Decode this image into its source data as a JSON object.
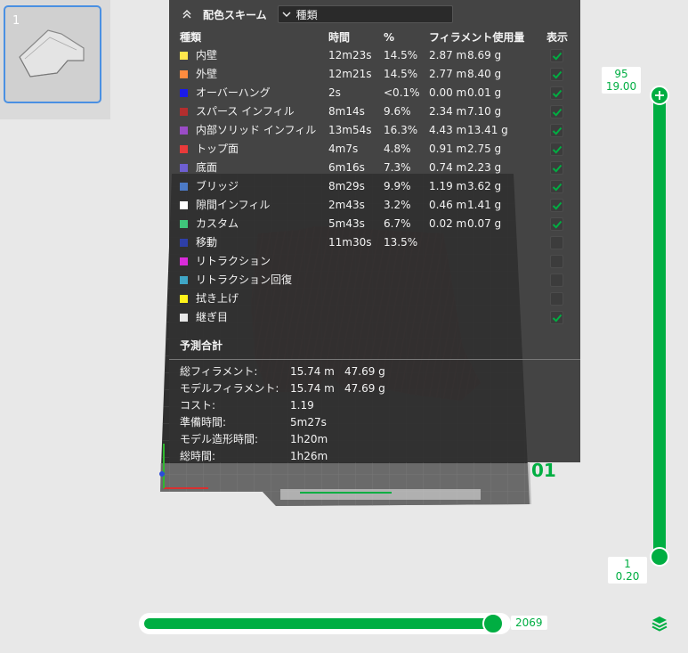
{
  "thumbnail": {
    "plate_number": "1"
  },
  "legend": {
    "title": "配色スキーム",
    "scheme_value": "種類",
    "columns": {
      "type": "種類",
      "time": "時間",
      "percent": "%",
      "filament": "フィラメント使用量",
      "display": "表示"
    },
    "rows": [
      {
        "name": "内壁",
        "color": "#FFE74C",
        "time": "12m23s",
        "percent": "14.5%",
        "length": "2.87 m",
        "weight": "8.69 g",
        "visible": true
      },
      {
        "name": "外壁",
        "color": "#FF8C3F",
        "time": "12m21s",
        "percent": "14.5%",
        "length": "2.77 m",
        "weight": "8.40 g",
        "visible": true
      },
      {
        "name": "オーバーハング",
        "color": "#1A1AE8",
        "time": "2s",
        "percent": "<0.1%",
        "length": "0.00 m",
        "weight": "0.01 g",
        "visible": true
      },
      {
        "name": "スパース インフィル",
        "color": "#B32E2E",
        "time": "8m14s",
        "percent": "9.6%",
        "length": "2.34 m",
        "weight": "7.10 g",
        "visible": true
      },
      {
        "name": "内部ソリッド インフィル",
        "color": "#9A4CC6",
        "time": "13m54s",
        "percent": "16.3%",
        "length": "4.43 m",
        "weight": "13.41 g",
        "visible": true
      },
      {
        "name": "トップ面",
        "color": "#E83A3A",
        "time": "4m7s",
        "percent": "4.8%",
        "length": "0.91 m",
        "weight": "2.75 g",
        "visible": true
      },
      {
        "name": "底面",
        "color": "#6E5FD1",
        "time": "6m16s",
        "percent": "7.3%",
        "length": "0.74 m",
        "weight": "2.23 g",
        "visible": true
      },
      {
        "name": "ブリッジ",
        "color": "#4C7AC6",
        "time": "8m29s",
        "percent": "9.9%",
        "length": "1.19 m",
        "weight": "3.62 g",
        "visible": true
      },
      {
        "name": "隙間インフィル",
        "color": "#FFFFFF",
        "time": "2m43s",
        "percent": "3.2%",
        "length": "0.46 m",
        "weight": "1.41 g",
        "visible": true
      },
      {
        "name": "カスタム",
        "color": "#3FC47A",
        "time": "5m43s",
        "percent": "6.7%",
        "length": "0.02 m",
        "weight": "0.07 g",
        "visible": true
      },
      {
        "name": "移動",
        "color": "#2E3FA8",
        "time": "11m30s",
        "percent": "13.5%",
        "length": "",
        "weight": "",
        "visible": false
      },
      {
        "name": "リトラクション",
        "color": "#D92BD9",
        "time": "",
        "percent": "",
        "length": "",
        "weight": "",
        "visible": false
      },
      {
        "name": "リトラクション回復",
        "color": "#3FA6C6",
        "time": "",
        "percent": "",
        "length": "",
        "weight": "",
        "visible": false
      },
      {
        "name": "拭き上げ",
        "color": "#FFF21A",
        "time": "",
        "percent": "",
        "length": "",
        "weight": "",
        "visible": false
      },
      {
        "name": "継ぎ目",
        "color": "#E8E8E8",
        "time": "",
        "percent": "",
        "length": "",
        "weight": "",
        "visible": true
      }
    ],
    "totals": {
      "title": "予測合計",
      "rows": [
        {
          "label": "総フィラメント:",
          "v1": "15.74 m",
          "v2": "47.69 g"
        },
        {
          "label": "モデルフィラメント:",
          "v1": "15.74 m",
          "v2": "47.69 g"
        },
        {
          "label": "コスト:",
          "v1": "1.19",
          "v2": ""
        },
        {
          "label": "準備時間:",
          "v1": "5m27s",
          "v2": ""
        },
        {
          "label": "モデル造形時間:",
          "v1": "1h20m",
          "v2": ""
        },
        {
          "label": "総時間:",
          "v1": "1h26m",
          "v2": ""
        }
      ]
    }
  },
  "plate": {
    "number": "01"
  },
  "layer_slider": {
    "top_layer": "95",
    "top_height": "19.00",
    "bottom_layer": "1",
    "bottom_height": "0.20"
  },
  "move_slider": {
    "value": "2069"
  },
  "colors": {
    "accent": "#00AE42",
    "panel": "#323232"
  },
  "icons": {
    "collapse": "double-chevron-up-icon",
    "dropdown": "chevron-down-icon",
    "check": "check-icon",
    "layers": "layers-icon"
  }
}
